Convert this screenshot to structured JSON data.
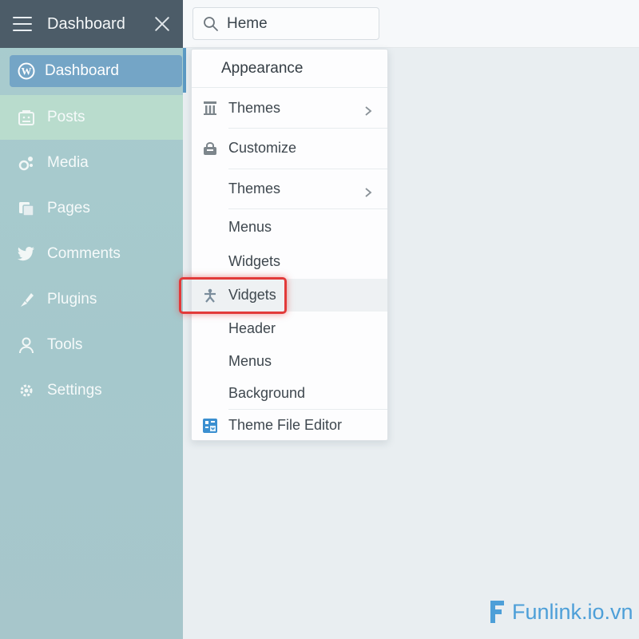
{
  "sidebar": {
    "title": "Dashboard",
    "items": [
      {
        "label": "Dashboard",
        "icon": "wordpress-icon"
      },
      {
        "label": "Posts",
        "icon": "posts-icon"
      },
      {
        "label": "Media",
        "icon": "media-icon"
      },
      {
        "label": "Pages",
        "icon": "pages-icon"
      },
      {
        "label": "Comments",
        "icon": "comments-icon"
      },
      {
        "label": "Plugins",
        "icon": "plugins-icon"
      },
      {
        "label": "Tools",
        "icon": "tools-icon"
      },
      {
        "label": "Settings",
        "icon": "settings-icon"
      }
    ]
  },
  "search": {
    "value": "Heme"
  },
  "menu": {
    "header": "Appearance",
    "items": [
      {
        "label": "Themes",
        "icon": "themes-icon",
        "submenu": true
      },
      {
        "label": "Customize",
        "icon": "customize-icon",
        "submenu": false
      },
      {
        "label": "Themes",
        "icon": "",
        "submenu": true
      },
      {
        "label": "Menus",
        "icon": "",
        "submenu": false
      },
      {
        "label": "Widgets",
        "icon": "",
        "submenu": false
      },
      {
        "label": "Vidgets",
        "icon": "widgets-icon",
        "submenu": false,
        "highlighted": true
      },
      {
        "label": "Header",
        "icon": "",
        "submenu": false
      },
      {
        "label": "Menus",
        "icon": "",
        "submenu": false
      },
      {
        "label": "Background",
        "icon": "",
        "submenu": false
      },
      {
        "label": "Theme File Editor",
        "icon": "theme-file-editor-icon",
        "submenu": false
      }
    ]
  },
  "watermark": {
    "text": "Funlink.io.vn"
  },
  "colors": {
    "accent": "#74a5c6",
    "highlight": "#e23a3a",
    "sidebar_head": "#4c5c68",
    "brand": "#4d9fd8"
  }
}
